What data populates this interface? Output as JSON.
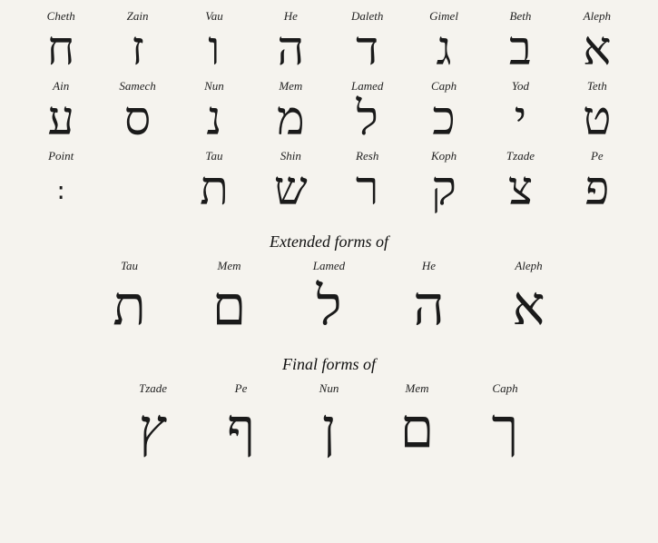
{
  "rows": [
    {
      "labels": [
        "Cheth",
        "Zain",
        "Vau",
        "He",
        "Daleth",
        "Gimel",
        "Beth",
        "Aleph"
      ],
      "glyphs": [
        "ח",
        "ז",
        "ו",
        "ה",
        "ד",
        "ג",
        "ב",
        "א"
      ]
    },
    {
      "labels": [
        "Ain",
        "Samech",
        "Nun",
        "Mem",
        "Lamed",
        "Caph",
        "Yod",
        "Teth"
      ],
      "glyphs": [
        "ע",
        "ס",
        "נ",
        "מ",
        "ל",
        "כ",
        "י",
        "ט"
      ]
    },
    {
      "labels": [
        "Point",
        "Tau",
        "Shin",
        "Resh",
        "Koph",
        "Tzade",
        "Pe",
        ""
      ],
      "glyphs": [
        ":",
        "ת",
        "ש",
        "ר",
        "ק",
        "צ",
        "פ",
        ""
      ]
    }
  ],
  "extended": {
    "title": "Extended forms of",
    "labels": [
      "Tau",
      "Mem",
      "Lamed",
      "He",
      "Aleph"
    ],
    "glyphs": [
      "ת",
      "ם",
      "ל",
      "ה",
      "א"
    ]
  },
  "final": {
    "title": "Final forms of",
    "labels": [
      "Tzade",
      "Pe",
      "Nun",
      "Mem",
      "Caph"
    ],
    "glyphs": [
      "ץ",
      "ף",
      "ן",
      "ם",
      "ך"
    ]
  }
}
